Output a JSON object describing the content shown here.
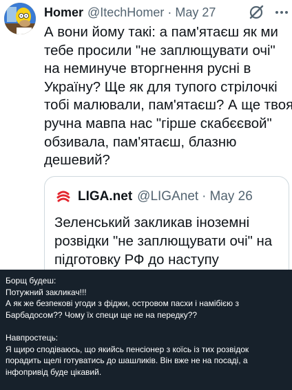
{
  "tweet": {
    "author_name": "Homer",
    "author_handle": "@ItechHomer",
    "separator": "·",
    "date": "May 27",
    "body_lines": [
      "А вони йому такі: а пам'ятаєш як ми",
      "тебе просили \"не заплющувати очі\"",
      "на неминуче вторгнення русні в",
      "Україну? Ще як для тупого стрілочкі",
      "тобі малювали, пам'ятаєш? А ще твоя",
      "ручна мавпа нас \"гірше скабєєвой\"",
      "обзивала, пам'ятаєш, блазню",
      "дешевий?"
    ],
    "icons": {
      "avatar": "homer-avatar",
      "grok": "grok-icon",
      "more": "more-icon"
    }
  },
  "quote": {
    "author_name": "LIGA.net",
    "author_handle": "@LIGAnet",
    "separator": "·",
    "date": "May 26",
    "body_lines": [
      "Зеленський закликав іноземні",
      "розвідки \"не заплющувати очі\" на",
      "підготовку РФ до наступу"
    ],
    "logo": "liga-logo",
    "brand_color": "#e3262e"
  },
  "caption": {
    "lines": [
      "Борщ будеш:",
      "Потужний закликач!!!",
      "А як же безпекові угоди з фіджи, островом пасхи і намібією з",
      "Барбадосом?? Чому їх специ ще не на передку??",
      "",
      "Навпростець:",
      "Я щиро сподіваюсь, що якийсь пенсіонер з коїсь із тих розвідок",
      "порадить щелі готуватись до шашликів. Він вже не на посаді, а",
      "інфопривід буде цікавий."
    ],
    "background": "#17212b"
  }
}
